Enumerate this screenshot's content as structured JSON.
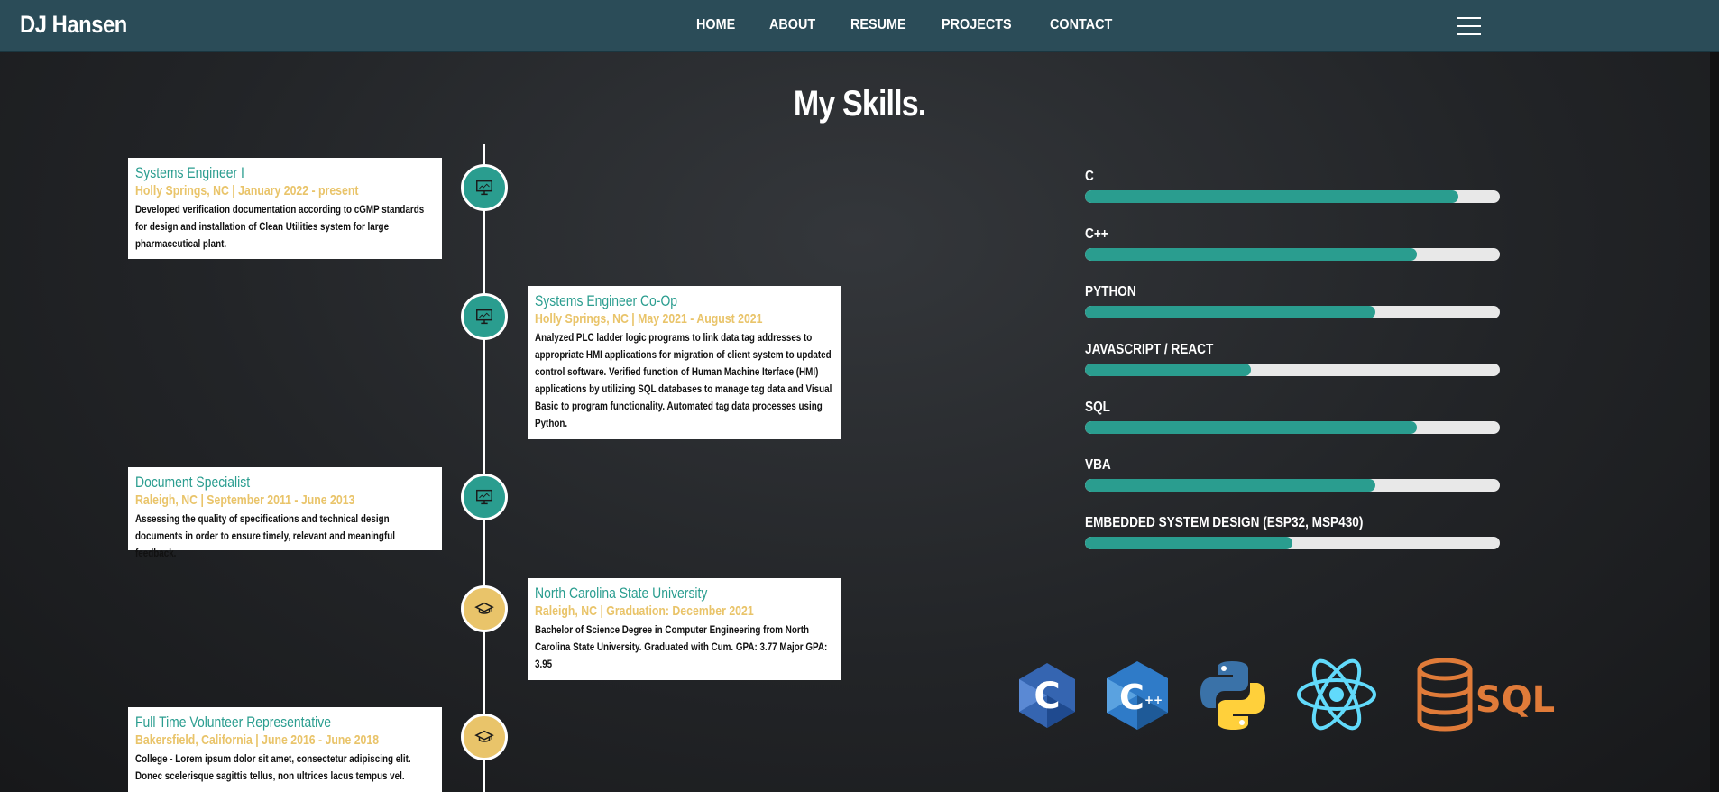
{
  "brand": "DJ Hansen",
  "nav": [
    "HOME",
    "ABOUT",
    "RESUME",
    "PROJECTS",
    "CONTACT"
  ],
  "section_title": "My Skills.",
  "timeline": [
    {
      "type": "work",
      "icon": "monitor-icon",
      "title": "Systems Engineer I",
      "sub": "Holly Springs, NC | January 2022 - present",
      "desc": "Developed verification documentation according to cGMP standards for design and installation of Clean Utilities system for large pharmaceutical plant."
    },
    {
      "type": "work",
      "icon": "monitor-icon",
      "title": "Systems Engineer Co-Op",
      "sub": "Holly Springs, NC | May 2021 - August 2021",
      "desc": "Analyzed PLC ladder logic programs to link data tag addresses to appropriate HMI applications for migration of client system to updated control software. Verified function of Human Machine Iterface (HMI) applications by utilizing SQL databases to manage tag data and Visual Basic to program functionality. Automated tag data processes using Python."
    },
    {
      "type": "work",
      "icon": "monitor-icon",
      "title": "Document Specialist",
      "sub": "Raleigh, NC | September 2011 - June 2013",
      "desc": "Assessing the quality of specifications and technical design documents in order to ensure timely, relevant and meaningful feedback."
    },
    {
      "type": "edu",
      "icon": "graduation-cap-icon",
      "title": "North Carolina State University",
      "sub": "Raleigh, NC | Graduation: December 2021",
      "desc": "Bachelor of Science Degree in Computer Engineering from North Carolina State University. Graduated with Cum. GPA: 3.77 Major GPA: 3.95"
    },
    {
      "type": "edu",
      "icon": "graduation-cap-icon",
      "title": "Full Time Volunteer Representative",
      "sub": "Bakersfield, California | June 2016 - June 2018",
      "desc": "College - Lorem ipsum dolor sit amet, consectetur adipiscing elit. Donec scelerisque sagittis tellus, non ultrices lacus tempus vel."
    }
  ],
  "skills": [
    {
      "name": "C",
      "level": 0.9
    },
    {
      "name": "C++",
      "level": 0.8
    },
    {
      "name": "PYTHON",
      "level": 0.7
    },
    {
      "name": "JAVASCRIPT / REACT",
      "level": 0.4
    },
    {
      "name": "SQL",
      "level": 0.8
    },
    {
      "name": "VBA",
      "level": 0.7
    },
    {
      "name": "EMBEDDED SYSTEM DESIGN (ESP32, MSP430)",
      "level": 0.5
    }
  ],
  "logos": {
    "c": "C",
    "cpp": "C",
    "cpp_plus": "++",
    "sql": "SQL"
  },
  "colors": {
    "accent": "#2a9d8f",
    "secondary": "#e9c46a",
    "navbar": "#2b4c58"
  }
}
